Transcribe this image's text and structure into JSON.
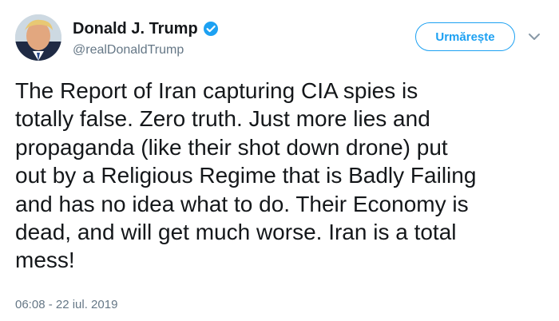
{
  "author": {
    "name": "Donald J. Trump",
    "handle": "@realDonaldTrump",
    "verified": true,
    "avatar_icon": "profile-photo"
  },
  "follow_button": {
    "label": "Urmărește"
  },
  "menu": {
    "icon": "chevron-down-icon"
  },
  "tweet": {
    "text": "The Report of Iran capturing CIA spies is\ntotally false. Zero truth. Just more lies and\npropaganda (like their shot down drone) put\nout by a Religious Regime that is Badly Failing\nand has no idea what to do. Their Economy is\ndead, and will get much worse. Iran is a total\nmess!",
    "timestamp": "06:08 - 22 iul. 2019"
  },
  "colors": {
    "accent": "#1da1f2",
    "text": "#14171a",
    "muted": "#657786"
  }
}
